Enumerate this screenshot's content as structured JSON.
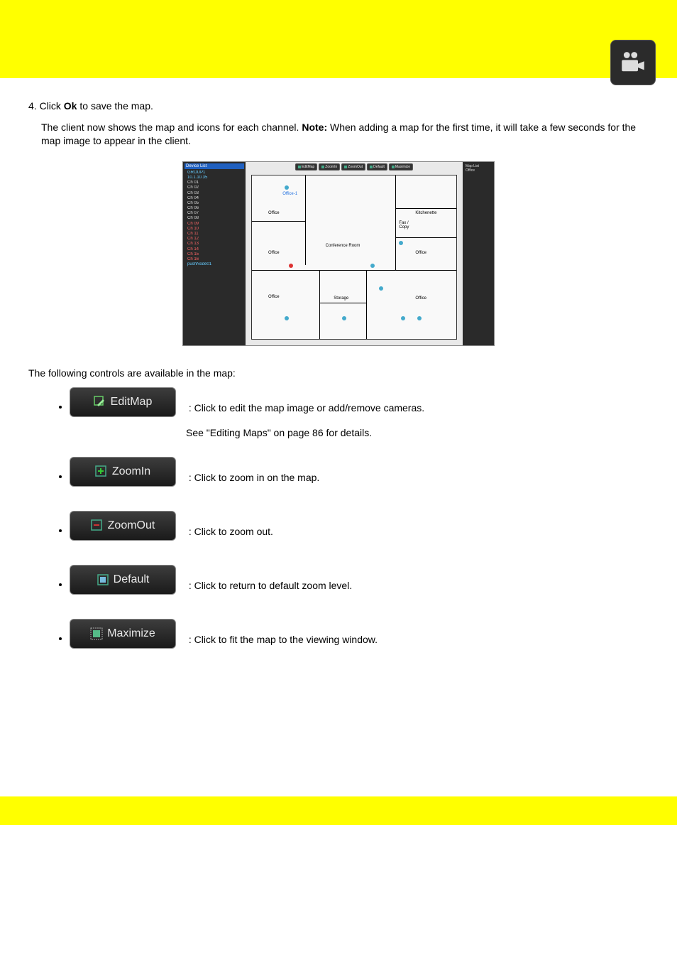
{
  "step4": {
    "prefix": "4. Click ",
    "bold": "Ok",
    "suffix": " to save the map."
  },
  "note": {
    "prefix": "The client now shows the map and icons for each channel. ",
    "bold": "Note: ",
    "suffix": "When adding a map for the first time, it will take a few seconds for the map image to appear in the client."
  },
  "screenshot": {
    "left_header": "Device List",
    "device_group": "GROUP1",
    "device_ip": "10.1.10.35",
    "channels_white": [
      "Ch 01",
      "Ch 02",
      "Ch 03",
      "Ch 04",
      "Ch 05",
      "Ch 06",
      "Ch 07",
      "Ch 08"
    ],
    "channels_red": [
      "Ch 09",
      "Ch 10",
      "Ch 11",
      "Ch 12",
      "Ch 13",
      "Ch 14",
      "Ch 15",
      "Ch 16"
    ],
    "channel_last": "pushNode01",
    "toolbar": [
      "EditMap",
      "ZoomIn",
      "ZoomOut",
      "Default",
      "Maximize"
    ],
    "rooms": {
      "office1": "Office",
      "office2": "Office",
      "office3": "Office",
      "office4": "Office",
      "office5": "Office",
      "conference": "Conference Room",
      "storage": "Storage",
      "kitchenette": "Kitchenette",
      "faxcopy": "Fax /\nCopy"
    },
    "camera_label": "Office-1",
    "right_panel": [
      "Map List",
      "Office"
    ]
  },
  "intro": "The following controls are available in the map:",
  "buttons": {
    "editmap": {
      "label": "EditMap",
      "desc_prefix": ": Click to edit the map image or add/remove cameras.",
      "desc_line2": "See \"Editing Maps\" on page 86 for details."
    },
    "zoomin": {
      "label": "ZoomIn",
      "desc": ": Click to zoom in on the map."
    },
    "zoomout": {
      "label": "ZoomOut",
      "desc": ": Click to zoom out."
    },
    "default": {
      "label": "Default",
      "desc": ": Click to return to default zoom level."
    },
    "maximize": {
      "label": "Maximize",
      "desc": ": Click to fit the map to the viewing window."
    }
  }
}
